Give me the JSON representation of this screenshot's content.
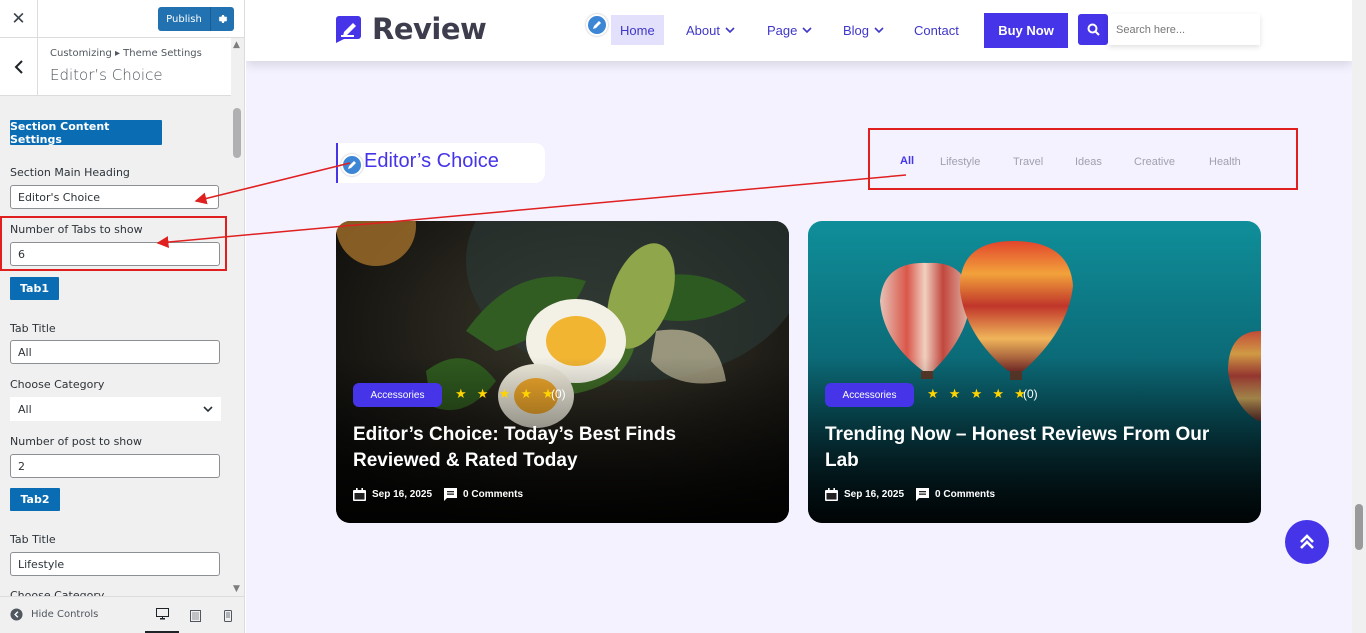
{
  "sidebar": {
    "publish_label": "Publish",
    "breadcrumb": "Customizing ▸ Theme Settings",
    "section_title": "Editor’s Choice",
    "content_settings_button": "Section Content Settings",
    "main_heading_label": "Section Main Heading",
    "main_heading_value": "Editor's Choice",
    "num_tabs_label": "Number of Tabs to show",
    "num_tabs_value": "6",
    "tab1": {
      "button": "Tab1",
      "title_label": "Tab Title",
      "title_value": "All",
      "category_label": "Choose Category",
      "category_value": "All",
      "posts_label": "Number of post to show",
      "posts_value": "2"
    },
    "tab2": {
      "button": "Tab2",
      "title_label": "Tab Title",
      "title_value": "Lifestyle",
      "category_label": "Choose Category"
    },
    "hide_controls": "Hide Controls"
  },
  "site": {
    "logo_text": "Review",
    "nav": {
      "home": "Home",
      "about": "About",
      "page": "Page",
      "blog": "Blog",
      "contact": "Contact"
    },
    "buy_now": "Buy Now",
    "search_placeholder": "Search here...",
    "accent_color": "#4534e8"
  },
  "section": {
    "heading": "Editor’s Choice",
    "tabs": [
      "All",
      "Lifestyle",
      "Travel",
      "Ideas",
      "Creative",
      "Health"
    ],
    "active_tab": "All"
  },
  "cards": [
    {
      "badge": "Accessories",
      "stars": "★ ★ ★ ★ ★",
      "rating_count": "(0)",
      "title": "Editor’s Choice: Today’s Best Finds Reviewed & Rated Today",
      "date": "Sep 16, 2025",
      "comments": "0 Comments"
    },
    {
      "badge": "Accessories",
      "stars": "★ ★ ★ ★ ★",
      "rating_count": "(0)",
      "title": "Trending Now – Honest Reviews From Our Lab",
      "date": "Sep 16, 2025",
      "comments": "0 Comments"
    }
  ]
}
